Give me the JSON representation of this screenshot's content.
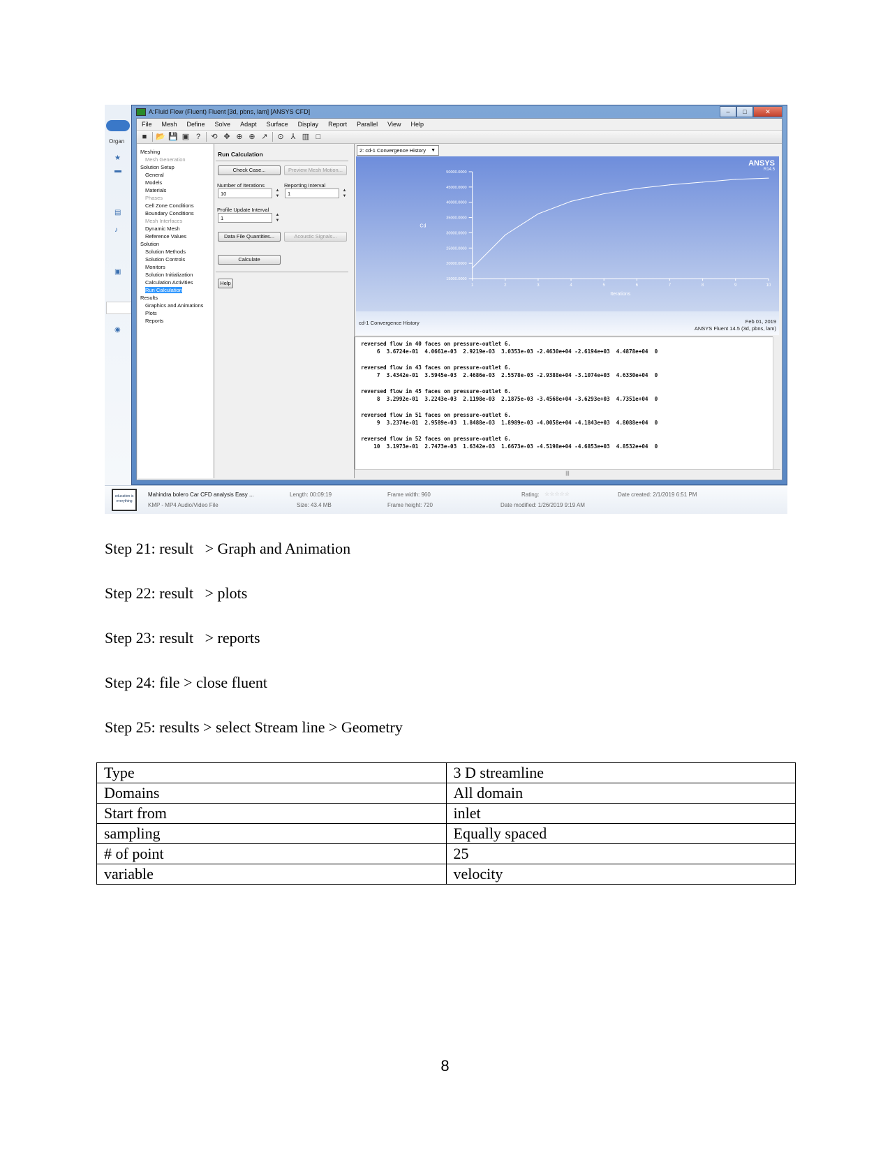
{
  "screenshot": {
    "window_title": "A:Fluid Flow (Fluent) Fluent  [3d, pbns, lam] [ANSYS CFD]",
    "window_buttons": [
      "minimize",
      "maximize",
      "close"
    ],
    "explorer_label": "Organ",
    "menu": [
      "File",
      "Mesh",
      "Define",
      "Solve",
      "Adapt",
      "Surface",
      "Display",
      "Report",
      "Parallel",
      "View",
      "Help"
    ],
    "toolbar_icons": [
      "stop-icon",
      "open-icon",
      "save-icon",
      "snapshot-icon",
      "help-icon",
      "rotate-icon",
      "pan-icon",
      "zoom-in-icon",
      "zoom-icon",
      "probe-icon",
      "zoom-fit-icon",
      "model-icon",
      "layout-icon",
      "window-icon"
    ],
    "tree": [
      {
        "label": "Meshing",
        "level": "header",
        "state": "normal"
      },
      {
        "label": "Mesh Generation",
        "level": "child",
        "state": "disabled"
      },
      {
        "label": "Solution Setup",
        "level": "header",
        "state": "normal"
      },
      {
        "label": "General",
        "level": "child",
        "state": "normal"
      },
      {
        "label": "Models",
        "level": "child",
        "state": "normal"
      },
      {
        "label": "Materials",
        "level": "child",
        "state": "normal"
      },
      {
        "label": "Phases",
        "level": "child",
        "state": "disabled"
      },
      {
        "label": "Cell Zone Conditions",
        "level": "child",
        "state": "normal"
      },
      {
        "label": "Boundary Conditions",
        "level": "child",
        "state": "normal"
      },
      {
        "label": "Mesh Interfaces",
        "level": "child",
        "state": "disabled"
      },
      {
        "label": "Dynamic Mesh",
        "level": "child",
        "state": "normal"
      },
      {
        "label": "Reference Values",
        "level": "child",
        "state": "normal"
      },
      {
        "label": "Solution",
        "level": "header",
        "state": "normal"
      },
      {
        "label": "Solution Methods",
        "level": "child",
        "state": "normal"
      },
      {
        "label": "Solution Controls",
        "level": "child",
        "state": "normal"
      },
      {
        "label": "Monitors",
        "level": "child",
        "state": "normal"
      },
      {
        "label": "Solution Initialization",
        "level": "child",
        "state": "normal"
      },
      {
        "label": "Calculation Activities",
        "level": "child",
        "state": "normal"
      },
      {
        "label": "Run Calculation",
        "level": "child",
        "state": "selected"
      },
      {
        "label": "Results",
        "level": "header",
        "state": "normal"
      },
      {
        "label": "Graphics and Animations",
        "level": "child",
        "state": "normal"
      },
      {
        "label": "Plots",
        "level": "child",
        "state": "normal"
      },
      {
        "label": "Reports",
        "level": "child",
        "state": "normal"
      }
    ],
    "task": {
      "title": "Run Calculation",
      "check_case": "Check Case...",
      "preview_mesh_motion": "Preview Mesh Motion...",
      "num_iterations_label": "Number of Iterations",
      "num_iterations_value": "10",
      "reporting_interval_label": "Reporting Interval",
      "reporting_interval_value": "1",
      "profile_update_label": "Profile Update Interval",
      "profile_update_value": "1",
      "data_file_quantities": "Data File Quantities...",
      "acoustic_signals": "Acoustic Signals...",
      "calculate": "Calculate",
      "help": "Help"
    },
    "graphics": {
      "window_select": "2: cd-1 Convergence History",
      "brand": "ANSYS",
      "brand_version": "R14.5",
      "footer_left": "cd-1 Convergence History",
      "footer_date": "Feb 01, 2019",
      "footer_solver": "ANSYS Fluent 14.5 (3d, pbns, lam)"
    },
    "console": [
      {
        "msg": "reversed flow in 40 faces on pressure-outlet 6.",
        "row": "     6  3.6724e-01  4.0661e-03  2.9219e-03  3.0353e-03 -2.4630e+04 -2.6194e+03  4.4878e+04  0"
      },
      {
        "msg": "reversed flow in 43 faces on pressure-outlet 6.",
        "row": "     7  3.4342e-01  3.5945e-03  2.4686e-03  2.5578e-03 -2.9388e+04 -3.1074e+03  4.6330e+04  0"
      },
      {
        "msg": "reversed flow in 45 faces on pressure-outlet 6.",
        "row": "     8  3.2992e-01  3.2243e-03  2.1198e-03  2.1875e-03 -3.4568e+04 -3.6293e+03  4.7351e+04  0"
      },
      {
        "msg": "reversed flow in 51 faces on pressure-outlet 6.",
        "row": "     9  3.2374e-01  2.9589e-03  1.8488e-03  1.8989e-03 -4.0058e+04 -4.1843e+03  4.8088e+04  0"
      },
      {
        "msg": "reversed flow in 52 faces on pressure-outlet 6.",
        "row": "    10  3.1973e-01  2.7473e-03  1.6342e-03  1.6673e-03 -4.5198e+04 -4.6853e+03  4.8532e+04  0"
      }
    ],
    "status": {
      "thumb_text": "education is everything",
      "file_name": "Mahindra bolero Car CFD analysis  Easy ...",
      "file_type": "KMP - MP4 Audio/Video File",
      "length": "Length: 00:09:19",
      "size": "Size: 43.4 MB",
      "frame_width": "Frame width: 960",
      "frame_height": "Frame height: 720",
      "rating": "Rating:",
      "rating_value": 0,
      "date_modified": "Date modified: 1/26/2019 9:19 AM",
      "date_created": "Date created: 2/1/2019 6:51 PM"
    }
  },
  "chart_data": {
    "type": "line",
    "title": "cd-1 Convergence History",
    "xlabel": "Iterations",
    "ylabel": "Cd",
    "x": [
      1,
      2,
      3,
      4,
      5,
      6,
      7,
      8,
      9,
      10
    ],
    "series": [
      {
        "name": "cd-1",
        "values": [
          18500,
          29300,
          36200,
          40300,
          42800,
          44500,
          45700,
          46600,
          47500,
          47900
        ]
      }
    ],
    "ylim": [
      15000,
      50000
    ],
    "xlim": [
      1,
      10
    ],
    "yticks": [
      "15000.0000",
      "20000.0000",
      "25000.0000",
      "30000.0000",
      "35000.0000",
      "40000.0000",
      "45000.0000",
      "50000.0000"
    ],
    "xticks": [
      "1",
      "2",
      "3",
      "4",
      "5",
      "6",
      "7",
      "8",
      "9",
      "10"
    ],
    "grid": false
  },
  "steps": [
    "Step 21: result   > Graph and Animation",
    "Step 22: result   > plots",
    "Step 23: result   > reports",
    "Step 24: file > close fluent",
    "Step 25: results > select Stream line > Geometry"
  ],
  "geometry_table": [
    [
      "Type",
      "3 D streamline"
    ],
    [
      "Domains",
      "All domain"
    ],
    [
      "Start from",
      "inlet"
    ],
    [
      "sampling",
      "Equally spaced"
    ],
    [
      "# of point",
      "25"
    ],
    [
      "variable",
      "velocity"
    ]
  ],
  "page_number": "8"
}
